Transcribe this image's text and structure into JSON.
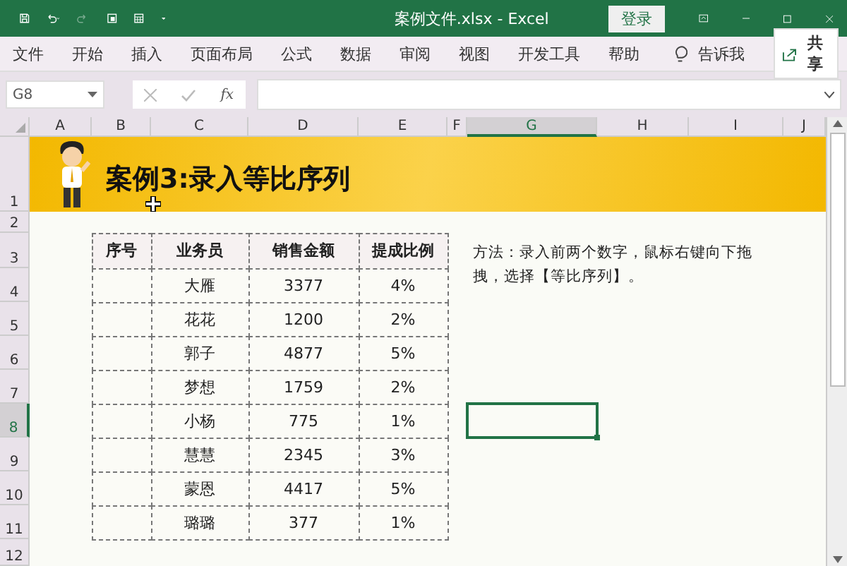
{
  "window": {
    "title": "案例文件.xlsx  -  Excel",
    "login_button": "登录"
  },
  "ribbon_tabs": [
    {
      "label": "文件"
    },
    {
      "label": "开始"
    },
    {
      "label": "插入"
    },
    {
      "label": "页面布局"
    },
    {
      "label": "公式"
    },
    {
      "label": "数据"
    },
    {
      "label": "审阅"
    },
    {
      "label": "视图"
    },
    {
      "label": "开发工具"
    },
    {
      "label": "帮助"
    }
  ],
  "tell_me": "告诉我",
  "share_button": "共享",
  "formula_bar": {
    "name_box": "G8",
    "fx": "fx"
  },
  "columns": [
    {
      "label": "A",
      "selected": false
    },
    {
      "label": "B",
      "selected": false
    },
    {
      "label": "C",
      "selected": false
    },
    {
      "label": "D",
      "selected": false
    },
    {
      "label": "E",
      "selected": false
    },
    {
      "label": "F",
      "selected": false
    },
    {
      "label": "G",
      "selected": true
    },
    {
      "label": "H",
      "selected": false
    },
    {
      "label": "I",
      "selected": false
    },
    {
      "label": "J",
      "selected": false
    }
  ],
  "rows": [
    {
      "label": "1",
      "selected": false
    },
    {
      "label": "2",
      "selected": false
    },
    {
      "label": "3",
      "selected": false
    },
    {
      "label": "4",
      "selected": false
    },
    {
      "label": "5",
      "selected": false
    },
    {
      "label": "6",
      "selected": false
    },
    {
      "label": "7",
      "selected": false
    },
    {
      "label": "8",
      "selected": true
    },
    {
      "label": "9",
      "selected": false
    },
    {
      "label": "10",
      "selected": false
    },
    {
      "label": "11",
      "selected": false
    },
    {
      "label": "12",
      "selected": false
    }
  ],
  "banner": {
    "title": "案例3:录入等比序列"
  },
  "table": {
    "columns": [
      "序号",
      "业务员",
      "销售金额",
      "提成比例"
    ],
    "rows": [
      {
        "name": "大雁",
        "amount": "3377",
        "ratio": "4%"
      },
      {
        "name": "花花",
        "amount": "1200",
        "ratio": "2%"
      },
      {
        "name": "郭子",
        "amount": "4877",
        "ratio": "5%"
      },
      {
        "name": "梦想",
        "amount": "1759",
        "ratio": "2%"
      },
      {
        "name": "小杨",
        "amount": "775",
        "ratio": "1%"
      },
      {
        "name": "慧慧",
        "amount": "2345",
        "ratio": "3%"
      },
      {
        "name": "蒙恩",
        "amount": "4417",
        "ratio": "5%"
      },
      {
        "name": "璐璐",
        "amount": "377",
        "ratio": "1%"
      }
    ]
  },
  "note": "方法：录入前两个数字，鼠标右键向下拖拽，选择【等比序列】。"
}
